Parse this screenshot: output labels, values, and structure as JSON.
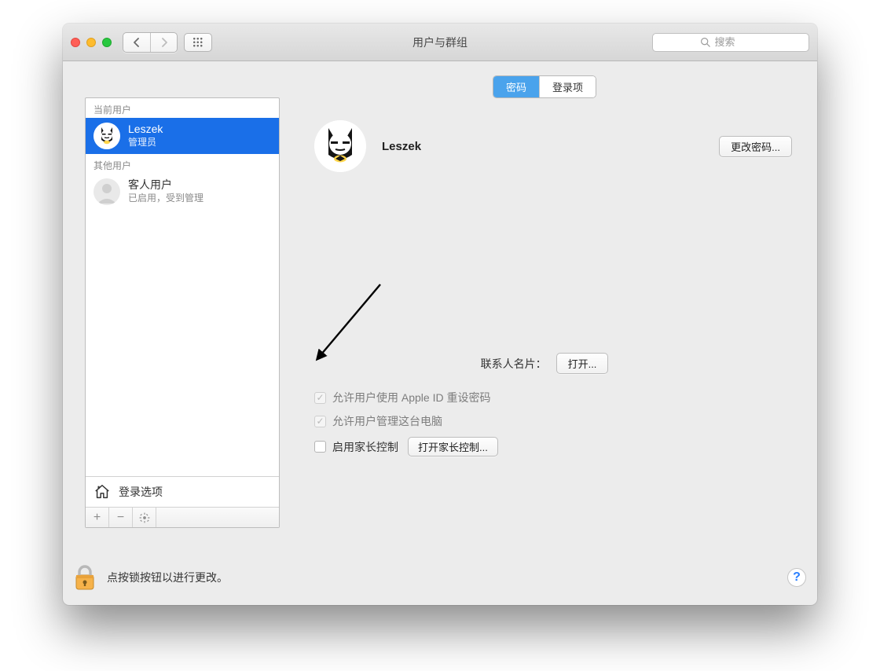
{
  "window": {
    "title": "用户与群组",
    "search_placeholder": "搜索"
  },
  "tabs": {
    "password": "密码",
    "login_items": "登录项",
    "active": "password"
  },
  "sidebar": {
    "current_user_header": "当前用户",
    "other_users_header": "其他用户",
    "current": {
      "name": "Leszek",
      "role": "管理员"
    },
    "guest": {
      "name": "客人用户",
      "status": "已启用，受到管理"
    },
    "login_options": "登录选项"
  },
  "profile": {
    "name": "Leszek",
    "change_password_label": "更改密码...",
    "contacts_label": "联系人名片：",
    "open_label": "打开..."
  },
  "options": {
    "allow_appleid_reset": "允许用户使用 Apple ID 重设密码",
    "allow_admin": "允许用户管理这台电脑",
    "enable_parental": "启用家长控制",
    "open_parental_button": "打开家长控制..."
  },
  "footer": {
    "lock_text": "点按锁按钮以进行更改。"
  }
}
